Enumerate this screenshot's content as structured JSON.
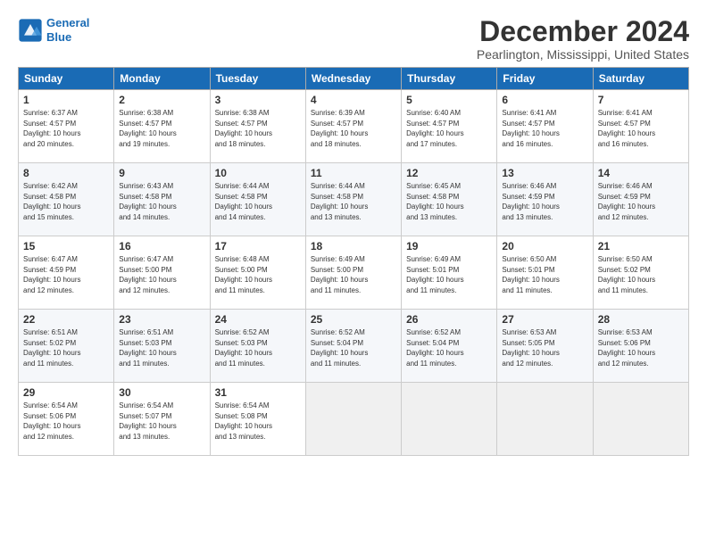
{
  "logo": {
    "line1": "General",
    "line2": "Blue"
  },
  "title": "December 2024",
  "subtitle": "Pearlington, Mississippi, United States",
  "headers": [
    "Sunday",
    "Monday",
    "Tuesday",
    "Wednesday",
    "Thursday",
    "Friday",
    "Saturday"
  ],
  "weeks": [
    [
      {
        "day": "1",
        "info": "Sunrise: 6:37 AM\nSunset: 4:57 PM\nDaylight: 10 hours\nand 20 minutes."
      },
      {
        "day": "2",
        "info": "Sunrise: 6:38 AM\nSunset: 4:57 PM\nDaylight: 10 hours\nand 19 minutes."
      },
      {
        "day": "3",
        "info": "Sunrise: 6:38 AM\nSunset: 4:57 PM\nDaylight: 10 hours\nand 18 minutes."
      },
      {
        "day": "4",
        "info": "Sunrise: 6:39 AM\nSunset: 4:57 PM\nDaylight: 10 hours\nand 18 minutes."
      },
      {
        "day": "5",
        "info": "Sunrise: 6:40 AM\nSunset: 4:57 PM\nDaylight: 10 hours\nand 17 minutes."
      },
      {
        "day": "6",
        "info": "Sunrise: 6:41 AM\nSunset: 4:57 PM\nDaylight: 10 hours\nand 16 minutes."
      },
      {
        "day": "7",
        "info": "Sunrise: 6:41 AM\nSunset: 4:57 PM\nDaylight: 10 hours\nand 16 minutes."
      }
    ],
    [
      {
        "day": "8",
        "info": "Sunrise: 6:42 AM\nSunset: 4:58 PM\nDaylight: 10 hours\nand 15 minutes."
      },
      {
        "day": "9",
        "info": "Sunrise: 6:43 AM\nSunset: 4:58 PM\nDaylight: 10 hours\nand 14 minutes."
      },
      {
        "day": "10",
        "info": "Sunrise: 6:44 AM\nSunset: 4:58 PM\nDaylight: 10 hours\nand 14 minutes."
      },
      {
        "day": "11",
        "info": "Sunrise: 6:44 AM\nSunset: 4:58 PM\nDaylight: 10 hours\nand 13 minutes."
      },
      {
        "day": "12",
        "info": "Sunrise: 6:45 AM\nSunset: 4:58 PM\nDaylight: 10 hours\nand 13 minutes."
      },
      {
        "day": "13",
        "info": "Sunrise: 6:46 AM\nSunset: 4:59 PM\nDaylight: 10 hours\nand 13 minutes."
      },
      {
        "day": "14",
        "info": "Sunrise: 6:46 AM\nSunset: 4:59 PM\nDaylight: 10 hours\nand 12 minutes."
      }
    ],
    [
      {
        "day": "15",
        "info": "Sunrise: 6:47 AM\nSunset: 4:59 PM\nDaylight: 10 hours\nand 12 minutes."
      },
      {
        "day": "16",
        "info": "Sunrise: 6:47 AM\nSunset: 5:00 PM\nDaylight: 10 hours\nand 12 minutes."
      },
      {
        "day": "17",
        "info": "Sunrise: 6:48 AM\nSunset: 5:00 PM\nDaylight: 10 hours\nand 11 minutes."
      },
      {
        "day": "18",
        "info": "Sunrise: 6:49 AM\nSunset: 5:00 PM\nDaylight: 10 hours\nand 11 minutes."
      },
      {
        "day": "19",
        "info": "Sunrise: 6:49 AM\nSunset: 5:01 PM\nDaylight: 10 hours\nand 11 minutes."
      },
      {
        "day": "20",
        "info": "Sunrise: 6:50 AM\nSunset: 5:01 PM\nDaylight: 10 hours\nand 11 minutes."
      },
      {
        "day": "21",
        "info": "Sunrise: 6:50 AM\nSunset: 5:02 PM\nDaylight: 10 hours\nand 11 minutes."
      }
    ],
    [
      {
        "day": "22",
        "info": "Sunrise: 6:51 AM\nSunset: 5:02 PM\nDaylight: 10 hours\nand 11 minutes."
      },
      {
        "day": "23",
        "info": "Sunrise: 6:51 AM\nSunset: 5:03 PM\nDaylight: 10 hours\nand 11 minutes."
      },
      {
        "day": "24",
        "info": "Sunrise: 6:52 AM\nSunset: 5:03 PM\nDaylight: 10 hours\nand 11 minutes."
      },
      {
        "day": "25",
        "info": "Sunrise: 6:52 AM\nSunset: 5:04 PM\nDaylight: 10 hours\nand 11 minutes."
      },
      {
        "day": "26",
        "info": "Sunrise: 6:52 AM\nSunset: 5:04 PM\nDaylight: 10 hours\nand 11 minutes."
      },
      {
        "day": "27",
        "info": "Sunrise: 6:53 AM\nSunset: 5:05 PM\nDaylight: 10 hours\nand 12 minutes."
      },
      {
        "day": "28",
        "info": "Sunrise: 6:53 AM\nSunset: 5:06 PM\nDaylight: 10 hours\nand 12 minutes."
      }
    ],
    [
      {
        "day": "29",
        "info": "Sunrise: 6:54 AM\nSunset: 5:06 PM\nDaylight: 10 hours\nand 12 minutes."
      },
      {
        "day": "30",
        "info": "Sunrise: 6:54 AM\nSunset: 5:07 PM\nDaylight: 10 hours\nand 13 minutes."
      },
      {
        "day": "31",
        "info": "Sunrise: 6:54 AM\nSunset: 5:08 PM\nDaylight: 10 hours\nand 13 minutes."
      },
      {
        "day": "",
        "info": ""
      },
      {
        "day": "",
        "info": ""
      },
      {
        "day": "",
        "info": ""
      },
      {
        "day": "",
        "info": ""
      }
    ]
  ]
}
